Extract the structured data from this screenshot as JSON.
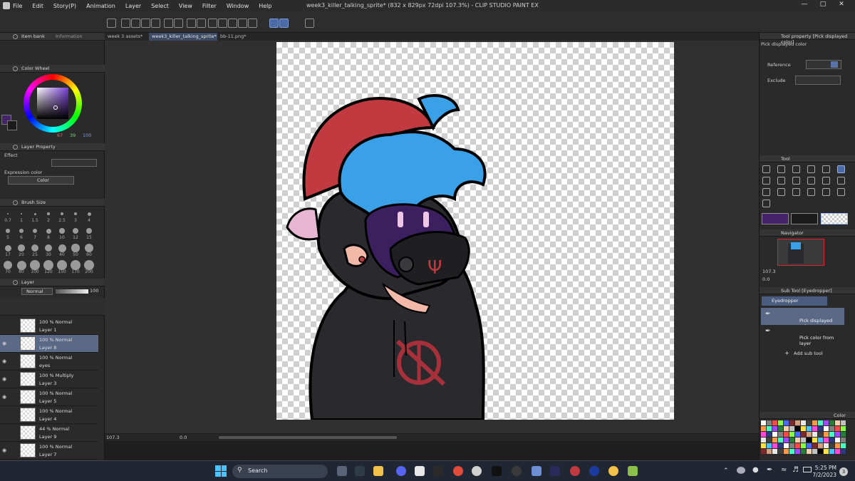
{
  "window": {
    "title": "week3_killer_talking_sprite* (832 x 829px 72dpi 107.3%)  -  CLIP STUDIO PAINT EX",
    "menu": [
      "File",
      "Edit",
      "Story(P)",
      "Animation",
      "Layer",
      "Select",
      "View",
      "Filter",
      "Window",
      "Help"
    ]
  },
  "doc_tabs": [
    {
      "label": "week 3 assets*"
    },
    {
      "label": "week3_killer_talking_sprite*"
    },
    {
      "label": "bb-11.png*"
    }
  ],
  "left": {
    "top_tabs": [
      "Item bank",
      "Information"
    ],
    "color_wheel": {
      "title": "Color Wheel",
      "r": "67",
      "g": "39",
      "b": "100",
      "main_color": "#44236b",
      "sub_color": "#1b1b1b"
    },
    "layer_property": {
      "title": "Layer Property",
      "effect": "Effect",
      "expression_label": "Expression color",
      "expression_value": "Color"
    },
    "brush_size": {
      "title": "Brush Size",
      "sizes": [
        "0.7",
        "1",
        "1.5",
        "2",
        "2.5",
        "3",
        "4",
        "5",
        "6",
        "7",
        "8",
        "10",
        "12",
        "15",
        "17",
        "20",
        "25",
        "30",
        "40",
        "50",
        "60",
        "70",
        "80",
        "100",
        "120",
        "150",
        "170",
        "200"
      ]
    },
    "layer": {
      "title": "Layer",
      "blend_mode": "Normal",
      "opacity": "100",
      "rows": [
        {
          "mode": "100 % Normal",
          "name": "Layer 1",
          "visible": false,
          "selected": false
        },
        {
          "mode": "100 % Normal",
          "name": "Layer 8",
          "visible": true,
          "selected": true
        },
        {
          "mode": "100 % Normal",
          "name": "eyes",
          "visible": true,
          "selected": false
        },
        {
          "mode": "100 % Multiply",
          "name": "Layer 3",
          "visible": true,
          "selected": false
        },
        {
          "mode": "100 % Normal",
          "name": "Layer 5",
          "visible": true,
          "selected": false
        },
        {
          "mode": "100 % Normal",
          "name": "Layer 4",
          "visible": false,
          "selected": false
        },
        {
          "mode": "44 % Normal",
          "name": "Layer 9",
          "visible": false,
          "selected": false
        },
        {
          "mode": "100 % Normal",
          "name": "Layer 7",
          "visible": true,
          "selected": false
        }
      ]
    }
  },
  "status": {
    "zoom": "107.3",
    "angle": "0.0"
  },
  "right": {
    "tool_property": {
      "title": "Tool property [Pick displayed color]",
      "subtitle": "Pick displayed color",
      "reference": "Reference",
      "exclude": "Exclude"
    },
    "tool": {
      "title": "Tool",
      "main_color": "#44236b",
      "sub_color": "#1b1b1b"
    },
    "navigator": {
      "title": "Navigator",
      "zoom": "107.3",
      "angle": "0.0"
    },
    "sub_tool": {
      "title": "Sub Tool [Eyedropper]",
      "group": "Eyedropper",
      "items": [
        "Pick displayed color",
        "Pick color from layer"
      ],
      "add": "Add sub tool"
    },
    "color_set": {
      "title": "Color"
    }
  },
  "taskbar": {
    "search": "Search",
    "time": "5:25 PM",
    "date": "7/2/2023",
    "notif": "3"
  }
}
